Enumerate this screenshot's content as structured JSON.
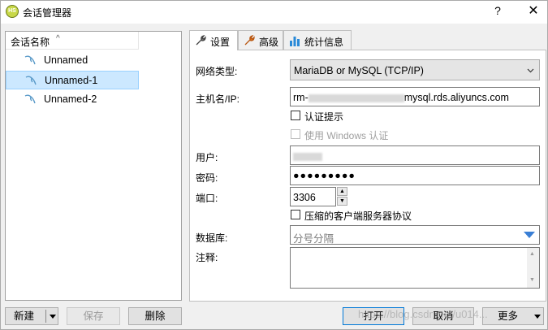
{
  "window": {
    "title": "会话管理器",
    "app_icon": "HS",
    "help_label": "?",
    "close_label": "✕"
  },
  "sessions": {
    "header": "会话名称",
    "items": [
      {
        "label": "Unnamed",
        "selected": false
      },
      {
        "label": "Unnamed-1",
        "selected": true
      },
      {
        "label": "Unnamed-2",
        "selected": false
      }
    ]
  },
  "tabs": [
    {
      "label": "设置",
      "icon": "wrench-icon",
      "active": true
    },
    {
      "label": "高级",
      "icon": "wrench-orange-icon",
      "active": false
    },
    {
      "label": "统计信息",
      "icon": "bar-chart-icon",
      "active": false
    }
  ],
  "settings": {
    "network_type_label": "网络类型:",
    "network_type_value": "MariaDB or MySQL (TCP/IP)",
    "hostname_label": "主机名/IP:",
    "hostname_prefix": "rm-",
    "hostname_suffix": "mysql.rds.aliyuncs.com",
    "auth_prompt_label": "认证提示",
    "windows_auth_label": "使用 Windows 认证",
    "user_label": "用户:",
    "password_label": "密码:",
    "password_value": "●●●●●●●●●",
    "port_label": "端口:",
    "port_value": "3306",
    "compress_label": "压缩的客户端服务器协议",
    "database_label": "数据库:",
    "database_placeholder": "分号分隔",
    "notes_label": "注释:"
  },
  "buttons": {
    "new": "新建",
    "save": "保存",
    "delete": "删除",
    "open": "打开",
    "cancel": "取消",
    "more": "更多"
  },
  "watermark": "https://blog.csdn.net/u014..."
}
